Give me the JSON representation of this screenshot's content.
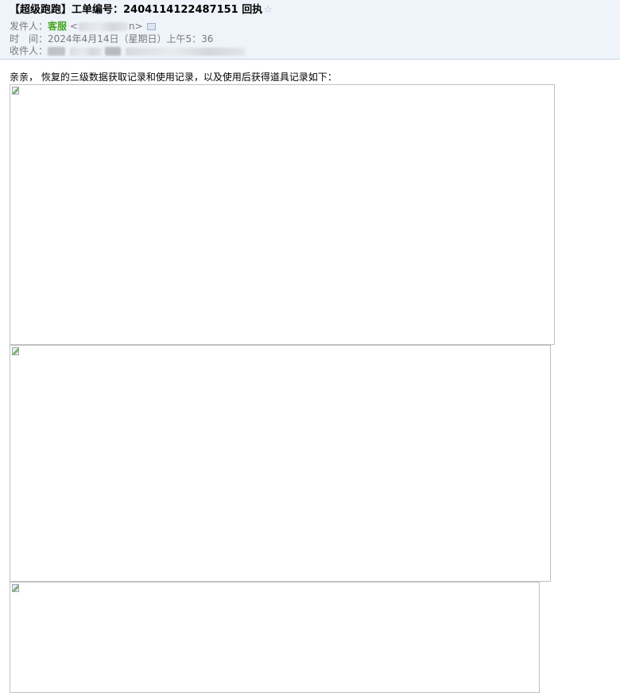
{
  "email": {
    "subject": "【超级跑跑】工单编号：2404114122487151 回执",
    "star_icon": "star-icon",
    "from_label": "发件人：",
    "sender_name": "客服",
    "email_open": "<",
    "email_close": "n>",
    "time_label": "时　间：",
    "time_value": "2024年4月14日（星期日）上午5：36",
    "to_label": "收件人：",
    "body_text": "亲亲， 恢复的三级数据获取记录和使用记录，以及使用后获得道具记录如下：",
    "images": [
      {
        "alt": ""
      },
      {
        "alt": ""
      },
      {
        "alt": ""
      }
    ]
  },
  "colors": {
    "header_bg": "#eff3fa",
    "sender_green": "#46a620",
    "meta_gray": "#7a7a7a"
  }
}
